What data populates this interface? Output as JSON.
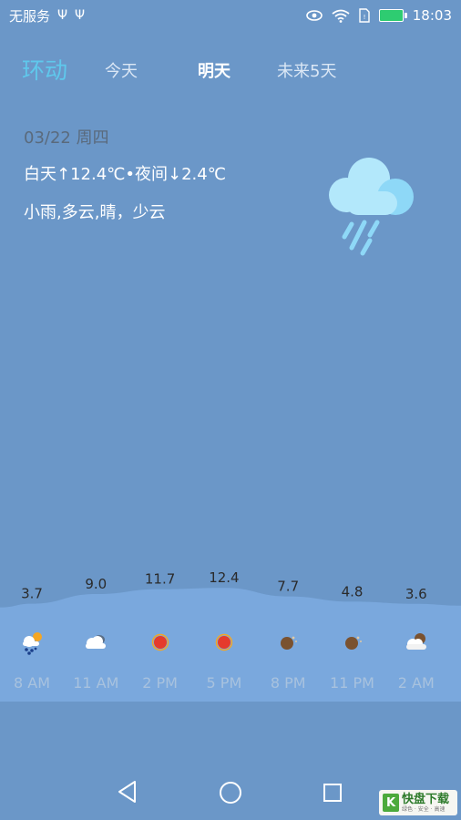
{
  "status_bar": {
    "carrier": "无服务",
    "time": "18:03",
    "icons": [
      "usb-icon",
      "usb-icon",
      "eye-icon",
      "wifi-icon",
      "sim-icon",
      "battery-icon"
    ]
  },
  "header": {
    "app_title": "环动",
    "tabs": [
      {
        "label": "今天",
        "active": false
      },
      {
        "label": "明天",
        "active": true
      },
      {
        "label": "未来5天",
        "active": false
      }
    ]
  },
  "summary": {
    "date": "03/22 周四",
    "temperature": "白天↑12.4℃•夜间↓2.4℃",
    "conditions": "小雨,多云,晴，少云",
    "icon": "rain-cloud-icon"
  },
  "chart_data": {
    "type": "area",
    "categories": [
      "8 AM",
      "11 AM",
      "2 PM",
      "5 PM",
      "8 PM",
      "11 PM",
      "2 AM"
    ],
    "values": [
      3.7,
      9.0,
      11.7,
      12.4,
      7.7,
      4.8,
      3.6
    ],
    "value_labels": [
      "3.7",
      "9.0",
      "11.7",
      "12.4",
      "7.7",
      "4.8",
      "3.6"
    ],
    "icons": [
      "sun-rain-cloud-icon",
      "cloud-icon",
      "sun-icon",
      "sun-icon",
      "moon-icon",
      "moon-icon",
      "moon-cloud-icon"
    ],
    "ylim": [
      0,
      13
    ],
    "grid": false,
    "colors": {
      "fill": "#7aa8dd",
      "label": "#2a2a2a"
    }
  },
  "nav_bar": {
    "icons": [
      "back-icon",
      "home-icon",
      "recent-apps-icon"
    ]
  },
  "watermark": {
    "logo_letter": "K",
    "text": "快盘下载",
    "subtext": "绿色 · 安全 · 高速"
  },
  "colors": {
    "background": "#6b97c8",
    "accent": "#5fc8ec",
    "battery": "#2ecc71"
  }
}
